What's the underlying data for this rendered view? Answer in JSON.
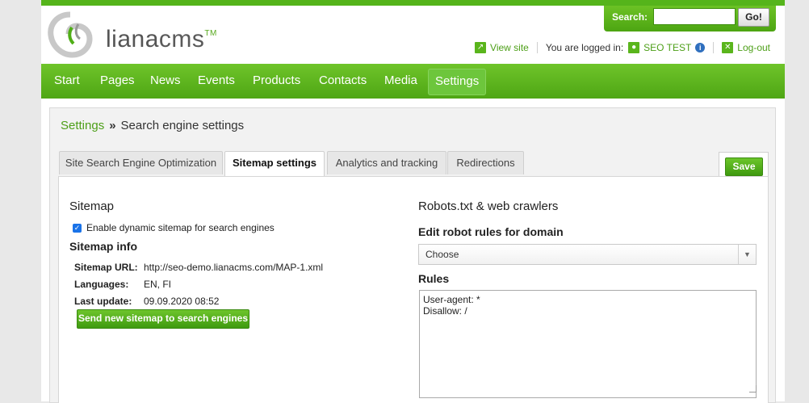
{
  "brand": {
    "name": "liana",
    "suffix": "cms",
    "tm": "TM"
  },
  "search": {
    "label": "Search:",
    "value": "",
    "go_label": "Go!"
  },
  "userbar": {
    "view_site": "View site",
    "logged_in_text": "You are logged in:",
    "user_name": "SEO TEST",
    "logout": "Log-out"
  },
  "nav": {
    "items": [
      "Start",
      "Pages",
      "News",
      "Events",
      "Products",
      "Contacts",
      "Media",
      "Settings"
    ],
    "active": "Settings"
  },
  "breadcrumb": {
    "parent": "Settings",
    "separator": "»",
    "current": "Search engine settings"
  },
  "tabs": [
    "Site Search Engine Optimization",
    "Sitemap settings",
    "Analytics and tracking",
    "Redirections"
  ],
  "active_tab": "Sitemap settings",
  "save_label": "Save",
  "sitemap": {
    "heading": "Sitemap",
    "checkbox_label": "Enable dynamic sitemap for search engines",
    "checkbox_checked": true,
    "info_heading": "Sitemap info",
    "url_label": "Sitemap URL:",
    "url_value": "http://seo-demo.lianacms.com/MAP-1.xml",
    "languages_label": "Languages:",
    "languages_value": "EN, FI",
    "last_update_label": "Last update:",
    "last_update_value": "09.09.2020 08:52",
    "send_button": "Send new sitemap to search engines"
  },
  "robots": {
    "heading": "Robots.txt & web crawlers",
    "edit_heading": "Edit robot rules for domain",
    "domain_select": "Choose",
    "rules_heading": "Rules",
    "rules_text": "User-agent: *\nDisallow: /"
  },
  "colors": {
    "brand_green": "#55b41b",
    "link_green": "#4d9f18",
    "info_blue": "#2f6fbe"
  }
}
